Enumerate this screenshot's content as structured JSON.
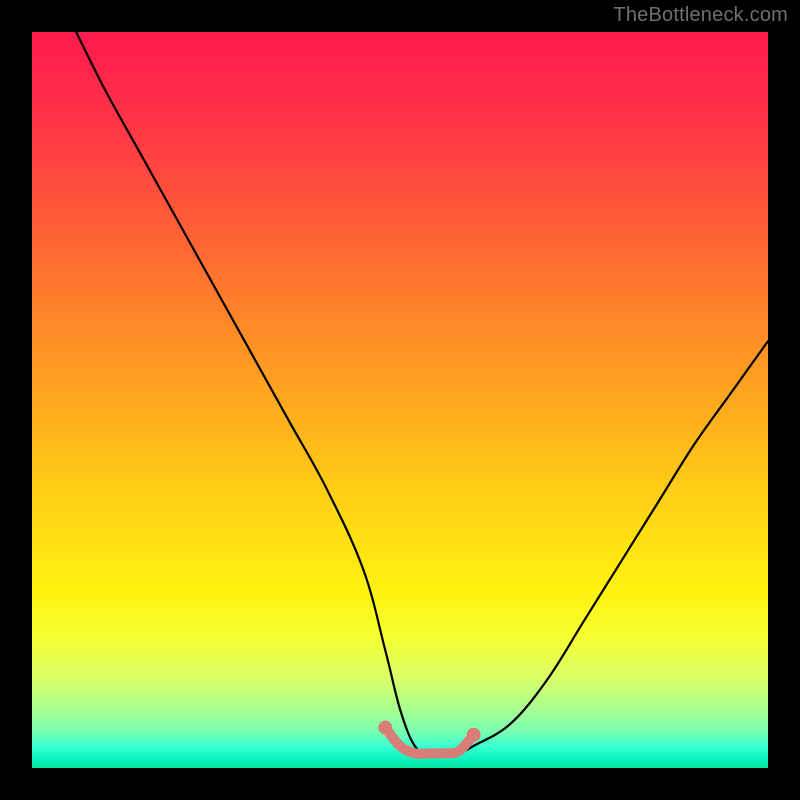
{
  "watermark": "TheBottleneck.com",
  "chart_data": {
    "type": "line",
    "title": "",
    "xlabel": "",
    "ylabel": "",
    "xlim": [
      0,
      100
    ],
    "ylim": [
      0,
      100
    ],
    "grid": false,
    "series": [
      {
        "name": "bottleneck-curve",
        "color": "#000000",
        "x": [
          6,
          10,
          15,
          20,
          25,
          30,
          35,
          40,
          45,
          48,
          50,
          52,
          54,
          56,
          58,
          60,
          65,
          70,
          75,
          80,
          85,
          90,
          95,
          100
        ],
        "y": [
          100,
          92,
          83,
          74,
          65,
          56,
          47,
          38,
          27,
          16,
          8,
          3,
          2,
          2,
          2,
          3,
          6,
          12,
          20,
          28,
          36,
          44,
          51,
          58
        ]
      },
      {
        "name": "target-segment",
        "color": "#d97d79",
        "x": [
          48,
          50,
          52,
          54,
          56,
          58,
          60
        ],
        "y": [
          5.5,
          3,
          2,
          2,
          2,
          2.3,
          4.5
        ]
      }
    ],
    "annotations": []
  },
  "colors": {
    "frame": "#000000",
    "curve": "#000000",
    "target_segment": "#d97d79",
    "watermark": "#6f6f6f"
  }
}
